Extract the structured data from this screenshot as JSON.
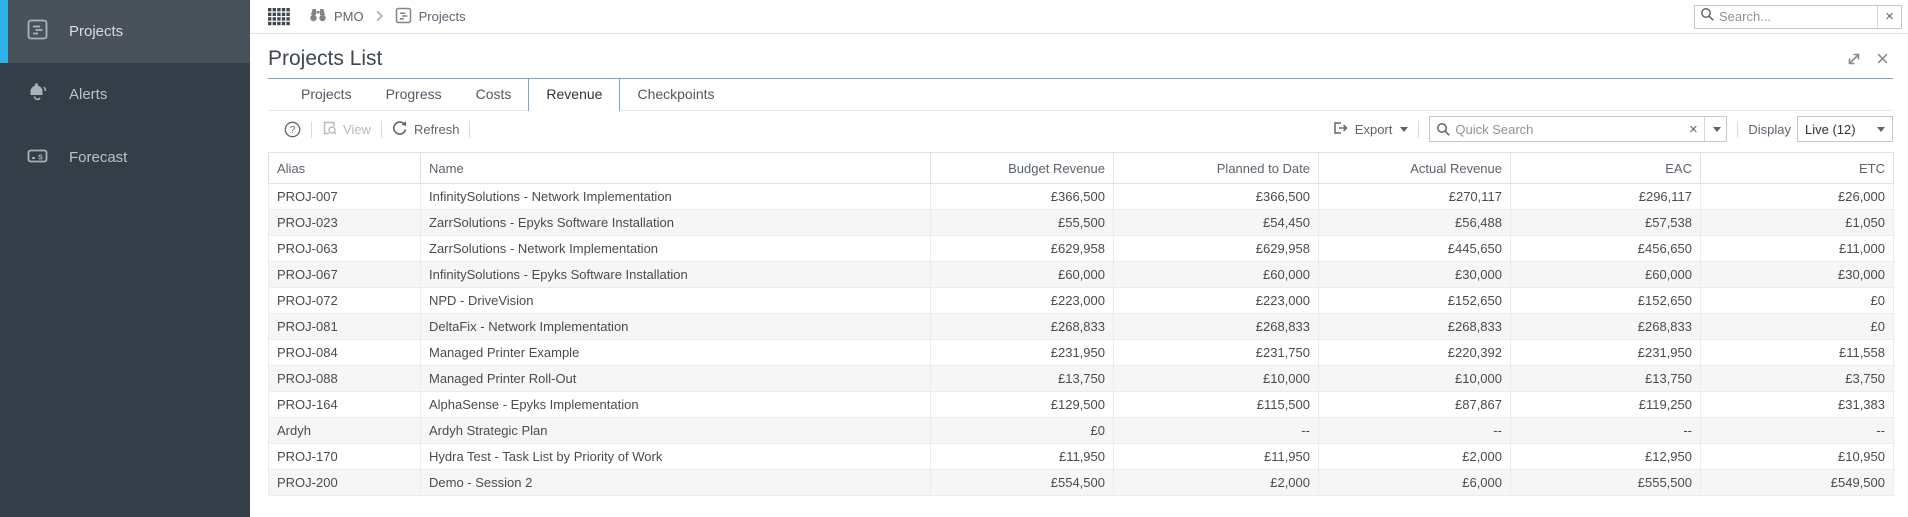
{
  "colors": {
    "accent": "#2fb2e8",
    "tab_border": "#74a7d4",
    "sidebar_bg": "#353e48",
    "sidebar_active_bg": "#49525b"
  },
  "sidebar": {
    "items": [
      {
        "label": "Projects",
        "icon": "projects-icon",
        "active": true
      },
      {
        "label": "Alerts",
        "icon": "alerts-icon",
        "active": false
      },
      {
        "label": "Forecast",
        "icon": "forecast-icon",
        "active": false
      }
    ]
  },
  "topbar": {
    "breadcrumb": {
      "app": "PMO",
      "page": "Projects"
    },
    "search": {
      "placeholder": "Search..."
    }
  },
  "panel": {
    "title": "Projects List",
    "tabs": [
      {
        "label": "Projects",
        "active": false
      },
      {
        "label": "Progress",
        "active": false
      },
      {
        "label": "Costs",
        "active": false
      },
      {
        "label": "Revenue",
        "active": true
      },
      {
        "label": "Checkpoints",
        "active": false
      }
    ]
  },
  "toolbar": {
    "view_label": "View",
    "refresh_label": "Refresh",
    "export_label": "Export",
    "quick_search_placeholder": "Quick Search",
    "display_label": "Display",
    "display_value": "Live (12)"
  },
  "table": {
    "columns": [
      "Alias",
      "Name",
      "Budget Revenue",
      "Planned to Date",
      "Actual Revenue",
      "EAC",
      "ETC"
    ],
    "rows": [
      [
        "PROJ-007",
        "InfinitySolutions - Network Implementation",
        "£366,500",
        "£366,500",
        "£270,117",
        "£296,117",
        "£26,000"
      ],
      [
        "PROJ-023",
        "ZarrSolutions - Epyks Software Installation",
        "£55,500",
        "£54,450",
        "£56,488",
        "£57,538",
        "£1,050"
      ],
      [
        "PROJ-063",
        "ZarrSolutions - Network Implementation",
        "£629,958",
        "£629,958",
        "£445,650",
        "£456,650",
        "£11,000"
      ],
      [
        "PROJ-067",
        "InfinitySolutions - Epyks Software Installation",
        "£60,000",
        "£60,000",
        "£30,000",
        "£60,000",
        "£30,000"
      ],
      [
        "PROJ-072",
        "NPD - DriveVision",
        "£223,000",
        "£223,000",
        "£152,650",
        "£152,650",
        "£0"
      ],
      [
        "PROJ-081",
        "DeltaFix - Network Implementation",
        "£268,833",
        "£268,833",
        "£268,833",
        "£268,833",
        "£0"
      ],
      [
        "PROJ-084",
        "Managed Printer Example",
        "£231,950",
        "£231,750",
        "£220,392",
        "£231,950",
        "£11,558"
      ],
      [
        "PROJ-088",
        "Managed Printer Roll-Out",
        "£13,750",
        "£10,000",
        "£10,000",
        "£13,750",
        "£3,750"
      ],
      [
        "PROJ-164",
        "AlphaSense - Epyks Implementation",
        "£129,500",
        "£115,500",
        "£87,867",
        "£119,250",
        "£31,383"
      ],
      [
        "Ardyh",
        "Ardyh Strategic Plan",
        "£0",
        "--",
        "--",
        "--",
        "--"
      ],
      [
        "PROJ-170",
        "Hydra Test - Task List by Priority of Work",
        "£11,950",
        "£11,950",
        "£2,000",
        "£12,950",
        "£10,950"
      ],
      [
        "PROJ-200",
        "Demo - Session 2",
        "£554,500",
        "£2,000",
        "£6,000",
        "£555,500",
        "£549,500"
      ]
    ]
  }
}
